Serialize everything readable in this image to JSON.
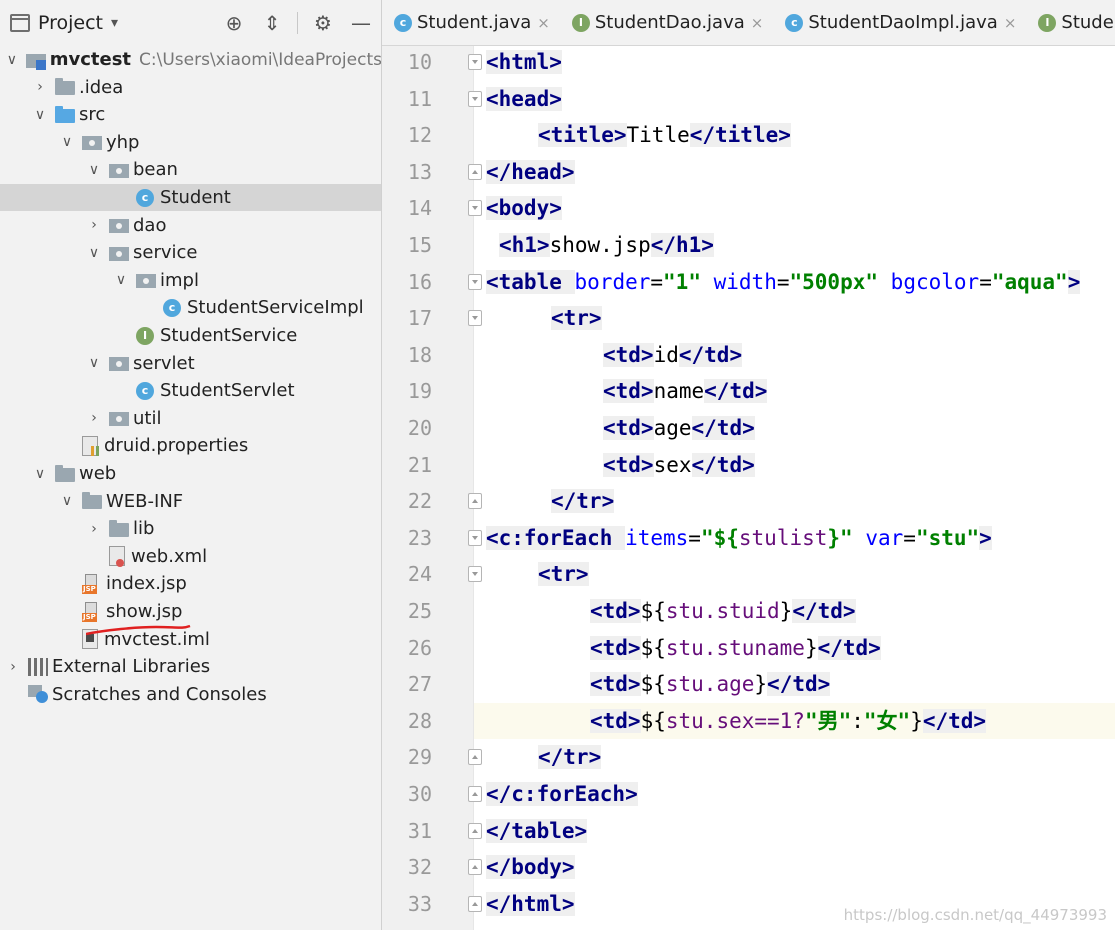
{
  "project_panel": {
    "title": "Project",
    "caret": "▾",
    "tree": [
      {
        "label": "mvctest",
        "path": "C:\\Users\\xiaomi\\IdeaProjects",
        "icon": "module-icon",
        "depth": 0,
        "arrow": "down",
        "bold": true
      },
      {
        "label": ".idea",
        "icon": "folder-icon",
        "depth": 1,
        "arrow": "right"
      },
      {
        "label": "src",
        "icon": "source-folder-icon",
        "depth": 1,
        "arrow": "down"
      },
      {
        "label": "yhp",
        "icon": "package-icon",
        "depth": 2,
        "arrow": "down"
      },
      {
        "label": "bean",
        "icon": "package-icon",
        "depth": 3,
        "arrow": "down"
      },
      {
        "label": "Student",
        "icon": "class-icon",
        "depth": 4,
        "arrow": "none",
        "selected": true
      },
      {
        "label": "dao",
        "icon": "package-icon",
        "depth": 3,
        "arrow": "right"
      },
      {
        "label": "service",
        "icon": "package-icon",
        "depth": 3,
        "arrow": "down"
      },
      {
        "label": "impl",
        "icon": "package-icon",
        "depth": 4,
        "arrow": "down"
      },
      {
        "label": "StudentServiceImpl",
        "icon": "class-icon",
        "depth": 5,
        "arrow": "none"
      },
      {
        "label": "StudentService",
        "icon": "interface-icon",
        "depth": 4,
        "arrow": "none"
      },
      {
        "label": "servlet",
        "icon": "package-icon",
        "depth": 3,
        "arrow": "down"
      },
      {
        "label": "StudentServlet",
        "icon": "class-icon",
        "depth": 4,
        "arrow": "none"
      },
      {
        "label": "util",
        "icon": "package-icon",
        "depth": 3,
        "arrow": "right"
      },
      {
        "label": "druid.properties",
        "icon": "properties-file-icon",
        "depth": 2,
        "arrow": "none"
      },
      {
        "label": "web",
        "icon": "web-folder-icon",
        "depth": 1,
        "arrow": "down"
      },
      {
        "label": "WEB-INF",
        "icon": "folder-icon",
        "depth": 2,
        "arrow": "down"
      },
      {
        "label": "lib",
        "icon": "folder-icon",
        "depth": 3,
        "arrow": "right"
      },
      {
        "label": "web.xml",
        "icon": "xml-file-icon",
        "depth": 3,
        "arrow": "none"
      },
      {
        "label": "index.jsp",
        "icon": "jsp-file-icon",
        "depth": 2,
        "arrow": "none"
      },
      {
        "label": "show.jsp",
        "icon": "jsp-file-icon",
        "depth": 2,
        "arrow": "none"
      },
      {
        "label": "mvctest.iml",
        "icon": "iml-file-icon",
        "depth": 2,
        "arrow": "none"
      },
      {
        "label": "External Libraries",
        "icon": "libraries-icon",
        "depth": 0,
        "arrow": "right"
      },
      {
        "label": "Scratches and Consoles",
        "icon": "scratches-icon",
        "depth": 0,
        "arrow": "none"
      }
    ]
  },
  "tabs": [
    {
      "label": "Student.java",
      "icon": "class-icon",
      "close": "×"
    },
    {
      "label": "StudentDao.java",
      "icon": "interface-icon",
      "close": "×"
    },
    {
      "label": "StudentDaoImpl.java",
      "icon": "class-icon",
      "close": "×"
    },
    {
      "label": "StudentSe",
      "icon": "interface-icon",
      "close": ""
    }
  ],
  "editor": {
    "current_line": 28,
    "lines": [
      {
        "num": "10",
        "indent": 0,
        "fold": "open",
        "tokens": [
          [
            "tg",
            "<html>"
          ]
        ]
      },
      {
        "num": "11",
        "indent": 0,
        "fold": "open",
        "tokens": [
          [
            "tg",
            "<head>"
          ]
        ]
      },
      {
        "num": "12",
        "indent": 4,
        "fold": "",
        "tokens": [
          [
            "tg",
            "<title>"
          ],
          [
            "el",
            "Title"
          ],
          [
            "tg",
            "</title>"
          ]
        ]
      },
      {
        "num": "13",
        "indent": 0,
        "fold": "close",
        "tokens": [
          [
            "tg",
            "</head>"
          ]
        ]
      },
      {
        "num": "14",
        "indent": 0,
        "fold": "open",
        "tokens": [
          [
            "tg",
            "<body>"
          ]
        ]
      },
      {
        "num": "15",
        "indent": 1,
        "fold": "",
        "tokens": [
          [
            "tg",
            "<h1>"
          ],
          [
            "el",
            "show.jsp"
          ],
          [
            "tg",
            "</h1>"
          ]
        ]
      },
      {
        "num": "16",
        "indent": 0,
        "fold": "open",
        "tokens": [
          [
            "tg",
            "<table "
          ],
          [
            "at",
            "border"
          ],
          [
            "el",
            "="
          ],
          [
            "av",
            "\"1\""
          ],
          [
            "el",
            " "
          ],
          [
            "at",
            "width"
          ],
          [
            "el",
            "="
          ],
          [
            "av",
            "\"500px\""
          ],
          [
            "el",
            " "
          ],
          [
            "at",
            "bgcolor"
          ],
          [
            "el",
            "="
          ],
          [
            "av",
            "\"aqua\""
          ],
          [
            "tg",
            ">"
          ]
        ]
      },
      {
        "num": "17",
        "indent": 5,
        "fold": "open",
        "tokens": [
          [
            "tg",
            "<tr>"
          ]
        ]
      },
      {
        "num": "18",
        "indent": 9,
        "fold": "",
        "tokens": [
          [
            "tg",
            "<td>"
          ],
          [
            "el",
            "id"
          ],
          [
            "tg",
            "</td>"
          ]
        ]
      },
      {
        "num": "19",
        "indent": 9,
        "fold": "",
        "tokens": [
          [
            "tg",
            "<td>"
          ],
          [
            "el",
            "name"
          ],
          [
            "tg",
            "</td>"
          ]
        ]
      },
      {
        "num": "20",
        "indent": 9,
        "fold": "",
        "tokens": [
          [
            "tg",
            "<td>"
          ],
          [
            "el",
            "age"
          ],
          [
            "tg",
            "</td>"
          ]
        ]
      },
      {
        "num": "21",
        "indent": 9,
        "fold": "",
        "tokens": [
          [
            "tg",
            "<td>"
          ],
          [
            "el",
            "sex"
          ],
          [
            "tg",
            "</td>"
          ]
        ]
      },
      {
        "num": "22",
        "indent": 5,
        "fold": "close",
        "tokens": [
          [
            "tg",
            "</tr>"
          ]
        ]
      },
      {
        "num": "23",
        "indent": 0,
        "fold": "open",
        "tokens": [
          [
            "tg",
            "<c:forEach "
          ],
          [
            "at",
            "items"
          ],
          [
            "el",
            "="
          ],
          [
            "av",
            "\"${"
          ],
          [
            "elv",
            "stulist"
          ],
          [
            "av",
            "}\""
          ],
          [
            "el",
            " "
          ],
          [
            "at",
            "var"
          ],
          [
            "el",
            "="
          ],
          [
            "av",
            "\"stu\""
          ],
          [
            "tg",
            ">"
          ]
        ]
      },
      {
        "num": "24",
        "indent": 4,
        "fold": "open",
        "tokens": [
          [
            "tg",
            "<tr>"
          ]
        ]
      },
      {
        "num": "25",
        "indent": 8,
        "fold": "",
        "tokens": [
          [
            "tg",
            "<td>"
          ],
          [
            "el",
            "${"
          ],
          [
            "elv",
            "stu.stuid"
          ],
          [
            "el",
            "}"
          ],
          [
            "tg",
            "</td>"
          ]
        ]
      },
      {
        "num": "26",
        "indent": 8,
        "fold": "",
        "tokens": [
          [
            "tg",
            "<td>"
          ],
          [
            "el",
            "${"
          ],
          [
            "elv",
            "stu.stuname"
          ],
          [
            "el",
            "}"
          ],
          [
            "tg",
            "</td>"
          ]
        ]
      },
      {
        "num": "27",
        "indent": 8,
        "fold": "",
        "tokens": [
          [
            "tg",
            "<td>"
          ],
          [
            "el",
            "${"
          ],
          [
            "elv",
            "stu.age"
          ],
          [
            "el",
            "}"
          ],
          [
            "tg",
            "</td>"
          ]
        ]
      },
      {
        "num": "28",
        "indent": 8,
        "fold": "",
        "tokens": [
          [
            "tg",
            "<td>"
          ],
          [
            "el",
            "${"
          ],
          [
            "elv",
            "stu.sex==1?"
          ],
          [
            "av",
            "\"男\""
          ],
          [
            "el",
            ":"
          ],
          [
            "av",
            "\"女\""
          ],
          [
            "el",
            "}"
          ],
          [
            "tg",
            "</td>"
          ]
        ]
      },
      {
        "num": "29",
        "indent": 4,
        "fold": "close",
        "tokens": [
          [
            "tg",
            "</tr>"
          ]
        ]
      },
      {
        "num": "30",
        "indent": 0,
        "fold": "close",
        "tokens": [
          [
            "tg",
            "</c:forEach>"
          ]
        ]
      },
      {
        "num": "31",
        "indent": 0,
        "fold": "close",
        "tokens": [
          [
            "tg",
            "</table>"
          ]
        ]
      },
      {
        "num": "32",
        "indent": 0,
        "fold": "close",
        "tokens": [
          [
            "tg",
            "</body>"
          ]
        ]
      },
      {
        "num": "33",
        "indent": 0,
        "fold": "close",
        "tokens": [
          [
            "tg",
            "</html>"
          ]
        ]
      }
    ]
  },
  "watermark": "https://blog.csdn.net/qq_44973993",
  "colors": {
    "tag": "#000080",
    "attr": "#0000ff",
    "value": "#008000",
    "selected_row": "#d5d5d5",
    "current_line": "#fcfaed",
    "annotation_red": "#e02020"
  }
}
